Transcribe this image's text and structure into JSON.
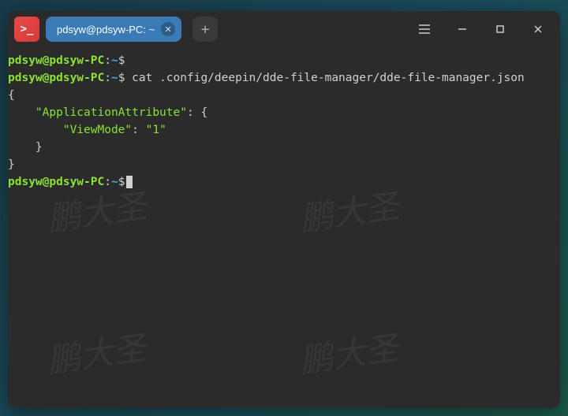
{
  "titlebar": {
    "tab_title": "pdsyw@pdsyw-PC: ~"
  },
  "prompt": {
    "user_host": "pdsyw@pdsyw-PC",
    "separator": ":",
    "path": "~",
    "symbol": "$"
  },
  "command": "cat .config/deepin/dde-file-manager/dde-file-manager.json",
  "output": {
    "open": "{",
    "key1": "\"ApplicationAttribute\"",
    "key1_suffix": ": {",
    "key2": "\"ViewMode\"",
    "key2_suffix": ": ",
    "val2": "\"1\"",
    "close_inner": "    }",
    "close": "}"
  },
  "watermark_text": "鹏大圣"
}
